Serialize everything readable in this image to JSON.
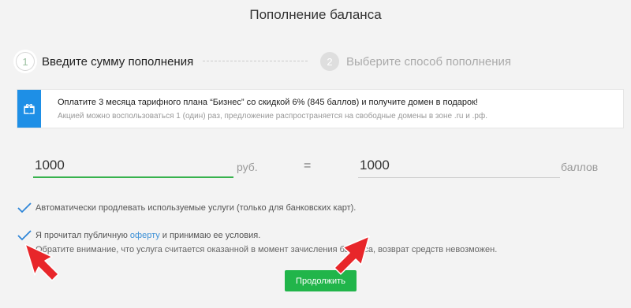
{
  "page": {
    "title": "Пополнение баланса"
  },
  "steps": [
    {
      "number": "1",
      "label": "Введите сумму пополнения"
    },
    {
      "number": "2",
      "label": "Выберите способ пополнения"
    }
  ],
  "promo": {
    "icon": "gift-icon",
    "text": "Оплатите 3 месяца тарифного плана “Бизнес” со скидкой 6% (845 баллов) и получите домен в подарок!",
    "subtext": "Акцией можно воспользоваться 1 (один) раз, предложение распространяется на свободные домены в зоне .ru и .рф.",
    "accent_color": "#1e8fe6"
  },
  "amount": {
    "rub_value": "1000",
    "rub_unit": "руб.",
    "equals": "=",
    "points_value": "1000",
    "points_unit": "баллов"
  },
  "checkboxes": {
    "autorenew": {
      "checked": true,
      "label": "Автоматически продлевать используемые услуги (только для банковских карт)."
    },
    "offer": {
      "checked": true,
      "label_before": "Я прочитал публичную ",
      "link": "оферту",
      "label_after": " и принимаю ее условия."
    }
  },
  "note": "Обратите внимание, что услуга считается оказанной в момент зачисления баланса, возврат средств невозможен.",
  "continue_button": {
    "label": "Продолжить",
    "color": "#21b54a"
  },
  "annotation_color": "#e8262a"
}
